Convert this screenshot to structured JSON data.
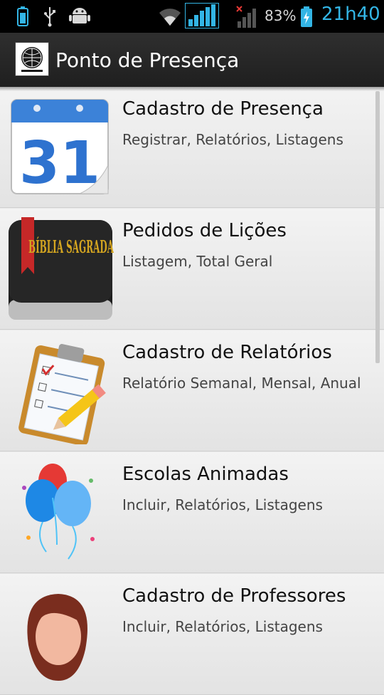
{
  "status_bar": {
    "battery_percent": "83%",
    "time": "21h40",
    "icons": [
      "battery-indicator-icon",
      "usb-icon",
      "android-debug-icon",
      "wifi-icon",
      "signal-icon",
      "no-signal-icon",
      "battery-charging-icon"
    ],
    "accent_color": "#33b5e5"
  },
  "action_bar": {
    "title": "Ponto de Presença",
    "logo_icon": "app-logo-icon"
  },
  "list": {
    "items": [
      {
        "title": "Cadastro de Presença",
        "subtitle": "Registrar, Relatórios, Listagens",
        "icon": "calendar-icon",
        "calendar_day": "31"
      },
      {
        "title": "Pedidos de Lições",
        "subtitle": "Listagem, Total Geral",
        "icon": "bible-icon",
        "book_title": "BÍBLIA SAGRADA"
      },
      {
        "title": "Cadastro de Relatórios",
        "subtitle": "Relatório Semanal, Mensal, Anual",
        "icon": "clipboard-icon"
      },
      {
        "title": "Escolas Animadas",
        "subtitle": "Incluir, Relatórios, Listagens",
        "icon": "balloons-icon"
      },
      {
        "title": "Cadastro de Professores",
        "subtitle": "Incluir, Relatórios, Listagens",
        "icon": "teacher-icon"
      }
    ]
  }
}
